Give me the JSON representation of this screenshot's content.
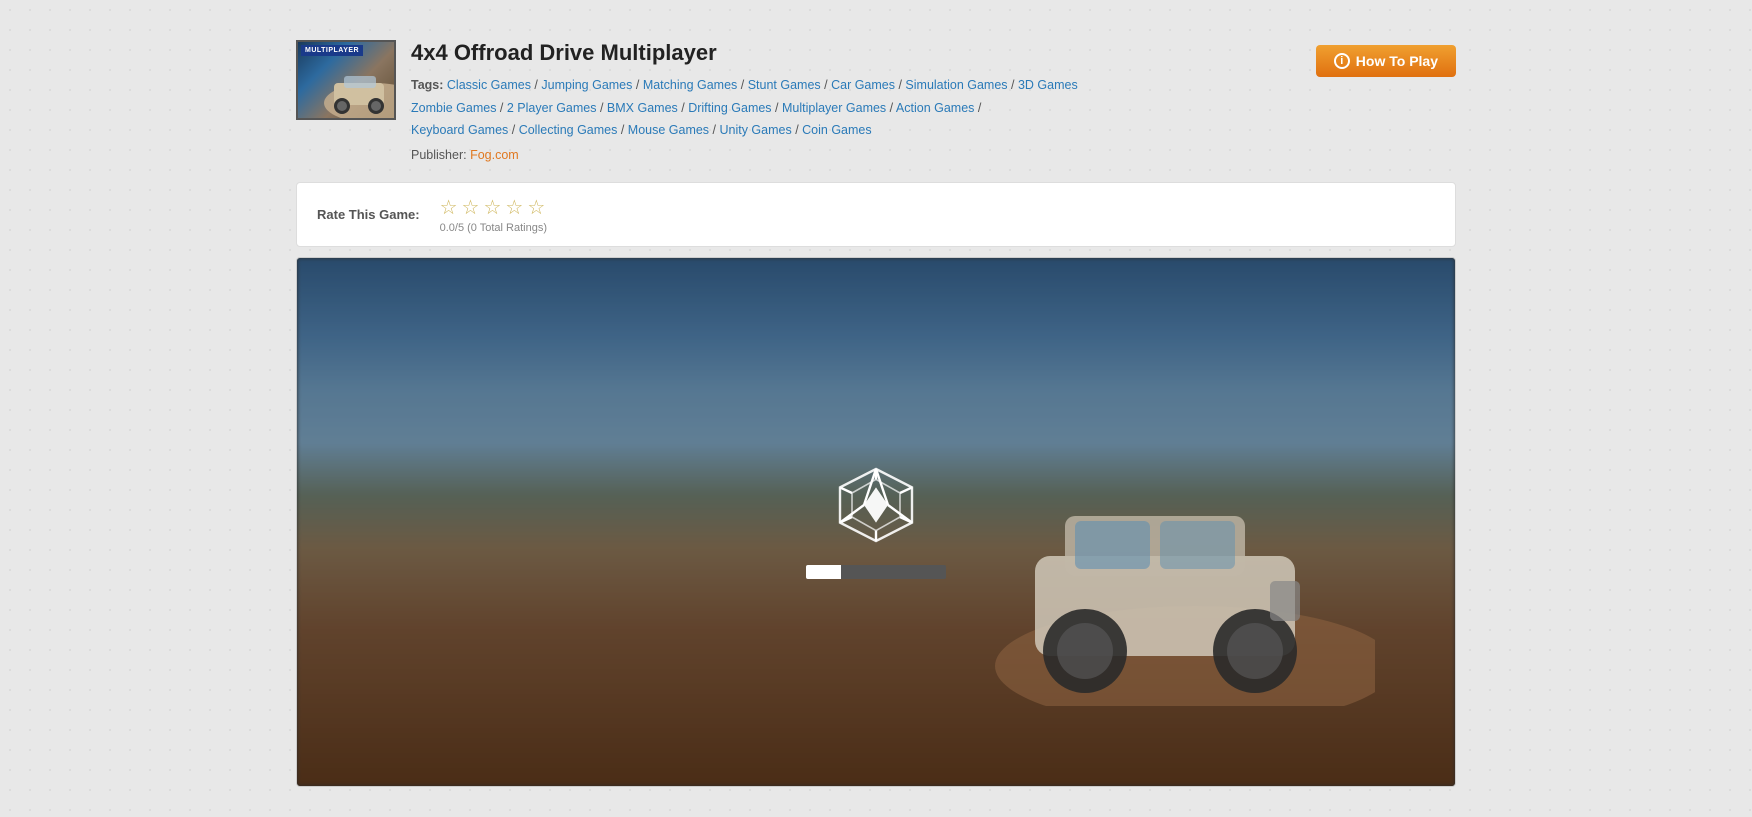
{
  "page": {
    "title": "4x4 Offroad Drive Multiplayer"
  },
  "header": {
    "game_title": "4x4 Offroad Drive Multiplayer",
    "thumbnail_badge": "MULTIPLAYER",
    "how_to_play_label": "How To Play",
    "publisher_label": "Publisher:",
    "publisher_name": "Fog.com",
    "tags_label": "Tags:",
    "tags": [
      "Classic Games",
      "Jumping Games",
      "Matching Games",
      "Stunt Games",
      "Car Games",
      "Simulation Games",
      "3D Games",
      "Zombie Games",
      "2 Player Games",
      "BMX Games",
      "Drifting Games",
      "Multiplayer Games",
      "Action Games",
      "Keyboard Games",
      "Collecting Games",
      "Mouse Games",
      "Unity Games",
      "Coin Games"
    ]
  },
  "rating": {
    "label": "Rate This Game:",
    "score": "0.0/5",
    "total": "(0 Total Ratings)"
  },
  "game": {
    "progress_percent": 25
  }
}
